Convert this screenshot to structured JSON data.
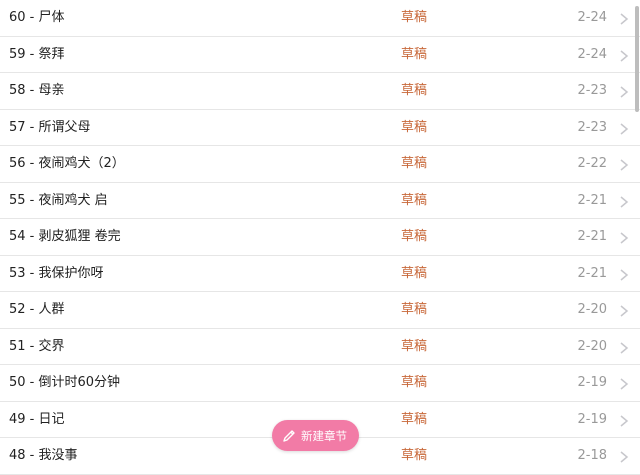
{
  "chapters": [
    {
      "title": "60 - 尸体",
      "status": "草稿",
      "date": "2-24"
    },
    {
      "title": "59 - 祭拜",
      "status": "草稿",
      "date": "2-24"
    },
    {
      "title": "58 - 母亲",
      "status": "草稿",
      "date": "2-23"
    },
    {
      "title": "57 - 所谓父母",
      "status": "草稿",
      "date": "2-23"
    },
    {
      "title": "56 - 夜闹鸡犬（2）",
      "status": "草稿",
      "date": "2-22"
    },
    {
      "title": "55 - 夜闹鸡犬 启",
      "status": "草稿",
      "date": "2-21"
    },
    {
      "title": "54 - 剥皮狐狸 卷完",
      "status": "草稿",
      "date": "2-21"
    },
    {
      "title": "53 - 我保护你呀",
      "status": "草稿",
      "date": "2-21"
    },
    {
      "title": "52 - 人群",
      "status": "草稿",
      "date": "2-20"
    },
    {
      "title": "51 - 交界",
      "status": "草稿",
      "date": "2-20"
    },
    {
      "title": "50 - 倒计时60分钟",
      "status": "草稿",
      "date": "2-19"
    },
    {
      "title": "49 - 日记",
      "status": "草稿",
      "date": "2-19"
    },
    {
      "title": "48 - 我没事",
      "status": "草稿",
      "date": "2-18"
    }
  ],
  "fab": {
    "label": "新建章节",
    "icon": "pencil-icon"
  },
  "icons": {
    "row_arrow": "chevron-right-icon"
  },
  "colors": {
    "status": "#c8683a",
    "fab": "#f27ba6",
    "date": "#999999",
    "title": "#222222"
  }
}
